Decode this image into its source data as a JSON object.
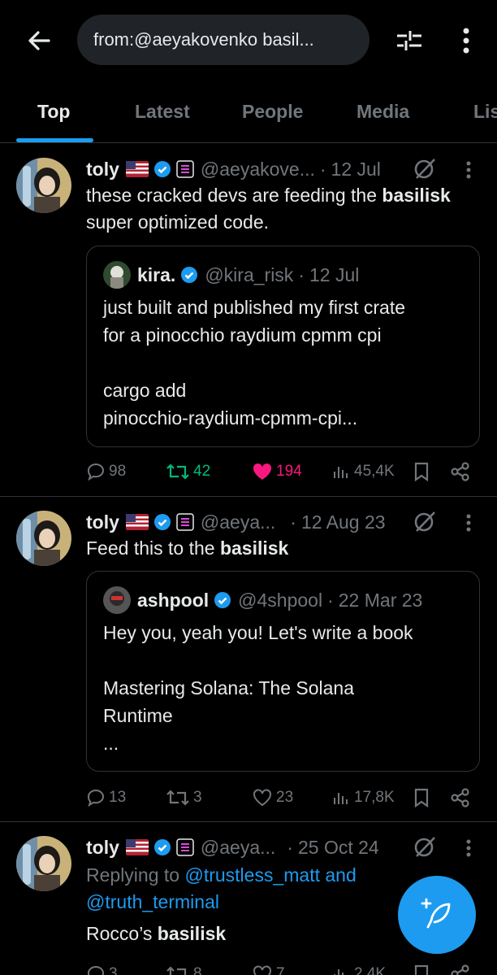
{
  "search": {
    "query": "from:@aeyakovenko basil..."
  },
  "tabs": [
    {
      "label": "Top",
      "active": true
    },
    {
      "label": "Latest"
    },
    {
      "label": "People"
    },
    {
      "label": "Media"
    },
    {
      "label": "Lis"
    }
  ],
  "tweets": [
    {
      "name": "toly",
      "handle": "@aeyakove...",
      "date": "12 Jul",
      "text_before": "these cracked devs are feeding the ",
      "highlight": "basilisk",
      "text_after": " super optimized code.",
      "quote": {
        "name": "kira.",
        "handle": "@kira_risk",
        "date": "12 Jul",
        "line1": "just built and published my first crate",
        "line2": "for a pinocchio raydium cpmm cpi",
        "line3": "cargo add",
        "line4": "pinocchio-raydium-cpmm-cpi..."
      },
      "replies": "98",
      "reposts": "42",
      "likes": "194",
      "views": "45,4K"
    },
    {
      "name": "toly",
      "handle": "@aeya...",
      "date": "12 Aug 23",
      "text_before": "Feed this to the ",
      "highlight": "basilisk",
      "text_after": "",
      "quote": {
        "name": "ashpool",
        "handle": "@4shpool",
        "date": "22 Mar 23",
        "line1": "Hey you, yeah you! Let's write a book",
        "line2": "",
        "line3": "Mastering Solana: The Solana",
        "line4": "Runtime",
        "line5": "..."
      },
      "replies": "13",
      "reposts": "3",
      "likes": "23",
      "views": "17,8K"
    },
    {
      "name": "toly",
      "handle": "@aeya...",
      "date": "25 Oct 24",
      "replying_prefix": "Replying to ",
      "replying_user1": "@trustless_matt",
      "replying_and": " and",
      "replying_user2": "@truth_terminal",
      "text_before": "Rocco’s ",
      "highlight": "basilisk",
      "replies": "3",
      "reposts": "8",
      "likes": "7",
      "views": "2,4K"
    }
  ],
  "colors": {
    "accent": "#1d9bf0",
    "like": "#f91880",
    "repost": "#00ba7c",
    "muted": "#71767b"
  }
}
